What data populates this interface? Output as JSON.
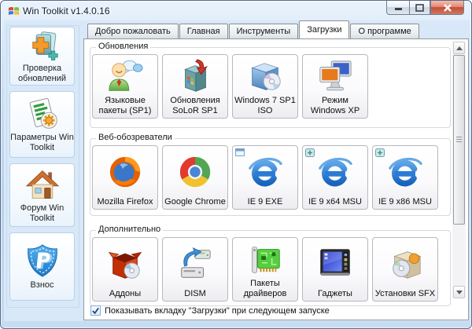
{
  "window": {
    "title": "Win Toolkit v1.4.0.16",
    "app_icon": "windows-flag-icon",
    "controls": [
      "minimize",
      "maximize",
      "close"
    ]
  },
  "sidebar": {
    "items": [
      {
        "label": "Проверка обновлений",
        "icon": "update-check-icon"
      },
      {
        "label": "Параметры Win Toolkit",
        "icon": "win-toolkit-options-icon"
      },
      {
        "label": "Форум Win Toolkit",
        "icon": "forum-home-icon"
      },
      {
        "label": "Взнос",
        "icon": "paypal-donate-icon"
      }
    ]
  },
  "tabs": [
    {
      "label": "Добро пожаловать",
      "active": false
    },
    {
      "label": "Главная",
      "active": false
    },
    {
      "label": "Инструменты",
      "active": false
    },
    {
      "label": "Загрузки",
      "active": true
    },
    {
      "label": "О программе",
      "active": false
    }
  ],
  "downloads_page": {
    "groups": [
      {
        "title": "Обновления",
        "buttons": [
          {
            "label": "Языковые пакеты (SP1)",
            "icon": "language-packs-icon"
          },
          {
            "label": "Обновления SoLoR SP1",
            "icon": "solor-updates-icon"
          },
          {
            "label": "Windows 7 SP1 ISO",
            "icon": "windows7-iso-icon"
          },
          {
            "label": "Режим Windows XP",
            "icon": "windows-xp-mode-icon"
          }
        ]
      },
      {
        "title": "Веб-обозреватели",
        "buttons": [
          {
            "label": "Mozilla Firefox",
            "icon": "firefox-icon"
          },
          {
            "label": "Google Chrome",
            "icon": "chrome-icon"
          },
          {
            "label": "IE 9 EXE",
            "icon": "internet-explorer-exe-icon"
          },
          {
            "label": "IE 9 x64 MSU",
            "icon": "internet-explorer-msu-icon"
          },
          {
            "label": "IE 9 x86 MSU",
            "icon": "internet-explorer-msu-icon"
          }
        ]
      },
      {
        "title": "Дополнительно",
        "buttons": [
          {
            "label": "Аддоны",
            "icon": "addons-box-icon"
          },
          {
            "label": "DISM",
            "icon": "dism-drives-icon"
          },
          {
            "label": "Пакеты драйверов",
            "icon": "driver-packs-icon"
          },
          {
            "label": "Гаджеты",
            "icon": "gadgets-icon"
          },
          {
            "label": "Установки SFX",
            "icon": "sfx-installs-icon"
          }
        ]
      }
    ],
    "footer_checkbox": {
      "label": "Показывать вкладку \"Загрузки\" при следующем запуске",
      "checked": true
    },
    "scrollbar": {
      "visible": true
    }
  },
  "colors": {
    "titlebar_glass": "#cfe2f3",
    "form_background": "#d9e8f8",
    "close_button_red": "#c14e38",
    "tab_page_background": "#ffffff",
    "group_border": "#d9d9dd",
    "tool_button_border": "#b8b8bd",
    "checkbox_check": "#21437c"
  }
}
